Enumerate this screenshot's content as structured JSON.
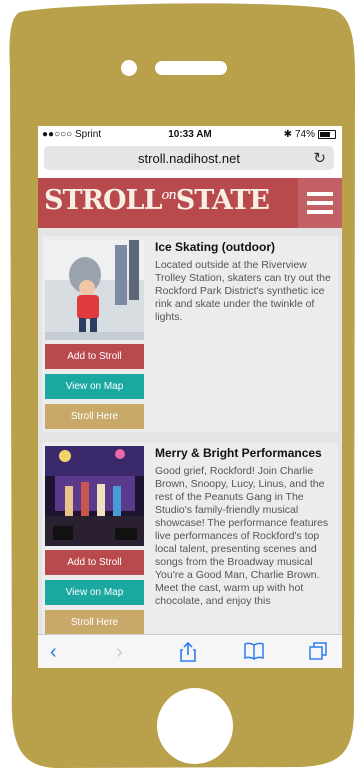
{
  "status": {
    "carrier": "●●○○○ Sprint",
    "time": "10:33 AM",
    "battery": "74%"
  },
  "browser": {
    "url": "stroll.nadihost.net",
    "reload": "↻"
  },
  "site": {
    "logo_left": "STROLL",
    "logo_on": "on",
    "logo_right": "STATE"
  },
  "events": [
    {
      "title": "Ice Skating (outdoor)",
      "description": "Located outside at the Riverview Trolley Station, skaters can try out the Rockford Park District's synthetic ice rink and skate under the twinkle of lights.",
      "add_label": "Add to Stroll",
      "map_label": "View on Map",
      "here_label": "Stroll Here"
    },
    {
      "title": "Merry & Bright Performances",
      "description": "Good grief, Rockford! Join Charlie Brown, Snoopy, Lucy, Linus, and the rest of the Peanuts Gang in The Studio's family-friendly musical showcase! The performance features live performances of Rockford's top local talent, presenting scenes and songs from the Broadway musical You're a Good Man, Charlie Brown. Meet the cast, warm up with hot chocolate, and enjoy this",
      "add_label": "Add to Stroll",
      "map_label": "View on Map",
      "here_label": "Stroll Here"
    }
  ],
  "colors": {
    "phone": "#b9a04a",
    "header": "#b84a4e",
    "add": "#b84a4e",
    "map": "#1aa8a0",
    "here": "#c8a96a"
  }
}
